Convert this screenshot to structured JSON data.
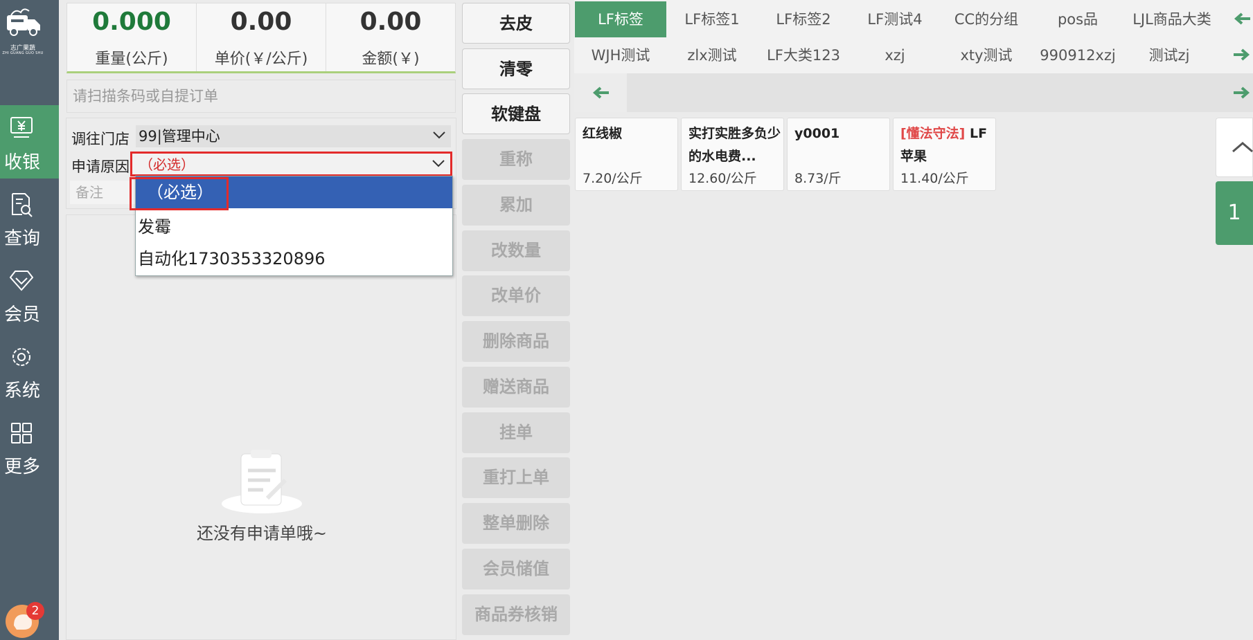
{
  "brand": {
    "name_cn": "志广果蔬",
    "name_en": "ZHI GUANG GUO SHU"
  },
  "nav": {
    "items": [
      {
        "label": "收银",
        "icon": "cashier-icon"
      },
      {
        "label": "查询",
        "icon": "query-icon"
      },
      {
        "label": "会员",
        "icon": "member-icon"
      },
      {
        "label": "系统",
        "icon": "settings-icon"
      },
      {
        "label": "更多",
        "icon": "grid-icon"
      }
    ],
    "active": "收银",
    "chat_badge": "2"
  },
  "scale": {
    "weight": {
      "value": "0.000",
      "label": "重量(公斤)"
    },
    "unit_price": {
      "value": "0.00",
      "label": "单价(￥/公斤)"
    },
    "amount": {
      "value": "0.00",
      "label": "金额(￥)"
    }
  },
  "scan_placeholder": "请扫描条码或自提订单",
  "form": {
    "store_label": "调往门店",
    "store_value": "99|管理中心",
    "reason_label": "申请原因",
    "reason_value": "（必选）",
    "remark_placeholder": "备注"
  },
  "dropdown": {
    "options": [
      "（必选）",
      "发霉",
      "自动化1730353320896"
    ],
    "selected": "（必选）"
  },
  "empty_text": "还没有申请单哦~",
  "functions": [
    {
      "label": "去皮",
      "enabled": true
    },
    {
      "label": "清零",
      "enabled": true
    },
    {
      "label": "软键盘",
      "enabled": true
    },
    {
      "label": "重称",
      "enabled": false
    },
    {
      "label": "累加",
      "enabled": false
    },
    {
      "label": "改数量",
      "enabled": false
    },
    {
      "label": "改单价",
      "enabled": false
    },
    {
      "label": "删除商品",
      "enabled": false
    },
    {
      "label": "赠送商品",
      "enabled": false
    },
    {
      "label": "挂单",
      "enabled": false
    },
    {
      "label": "重打上单",
      "enabled": false
    },
    {
      "label": "整单删除",
      "enabled": false
    },
    {
      "label": "会员储值",
      "enabled": false
    },
    {
      "label": "商品券核销",
      "enabled": false
    }
  ],
  "categories_row1": [
    "LF标签",
    "LF标签1",
    "LF标签2",
    "LF测试4",
    "CC的分组",
    "pos品",
    "LJL商品大类"
  ],
  "categories_row2": [
    "WJH测试",
    "zlx测试",
    "LF大类123",
    "xzj",
    "xty测试",
    "990912xzj",
    "测试zj"
  ],
  "active_category": "LF标签",
  "products": [
    {
      "tag": "",
      "name": "红线椒",
      "price": "7.20/公斤"
    },
    {
      "tag": "",
      "name": "实打实胜多负少的水电费...",
      "price": "12.60/公斤"
    },
    {
      "tag": "",
      "name": "y0001",
      "price": "8.73/斤"
    },
    {
      "tag": "[懂法守法]",
      "name": "LF苹果",
      "price": "11.40/公斤"
    }
  ],
  "page_number": "1",
  "colors": {
    "accent": "#4d9c6d",
    "sidebar": "#4f5f6b",
    "alert": "#e32b2b",
    "selection": "#3461b4"
  }
}
